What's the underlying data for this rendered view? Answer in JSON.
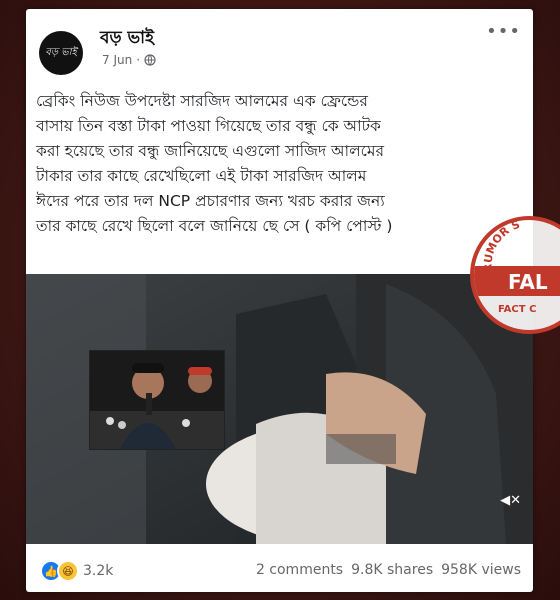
{
  "page": {
    "name": "বড় ভাই",
    "avatar_text": "বড় ভাই",
    "date": "7 Jun",
    "separator": "·"
  },
  "post": {
    "text": "ব্রেকিং নিউজ উপদেষ্টা সারজিদ আলমের এক ফ্রেন্ডের\nবাসায় তিন বস্তা টাকা পাওয়া গিয়েছে তার বন্ধু কে আটক\nকরা হয়েছে তার বন্ধু জানিয়েছে এগুলো সাজিদ আলমের\nটাকার তার কাছে রেখেছিলো এই টাকা সারজিদ আলম\nঈদের  পরে তার দল NCP প্রচারণার জন্য খরচ করার জন্য\nতার কাছে রেখে ছিলো বলে জানিয়ে ছে সে  ( কপি পোস্ট )"
  },
  "stats": {
    "reactions": "3.2k",
    "comments": "2 comments",
    "shares": "9.8K shares",
    "views": "958K views"
  },
  "stamp": {
    "top_text": "RUMOR S",
    "main_text": "FAL",
    "bottom_text": "FACT C"
  },
  "colors": {
    "brand_blue": "#1877f2",
    "stamp_red": "#c0392b",
    "background": "#3a1512"
  },
  "icons": {
    "more": "more-horizontal-icon",
    "globe": "globe-icon",
    "like": "like-icon",
    "haha": "haha-icon",
    "mute": "mute-icon"
  }
}
